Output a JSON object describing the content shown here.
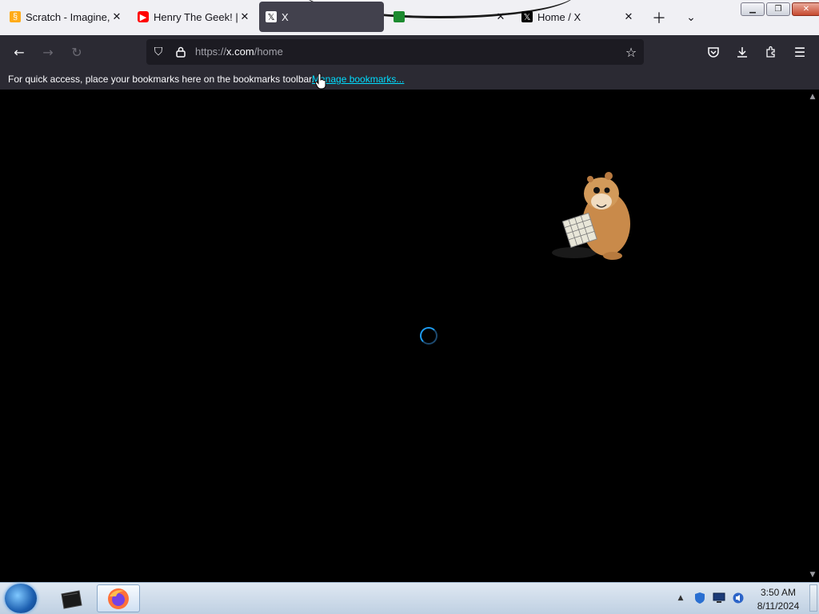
{
  "tabs": [
    {
      "title": "Scratch - Imagine, P",
      "favicon": "scratch-icon"
    },
    {
      "title": "Henry The Geek! | H",
      "favicon": "youtube-icon"
    },
    {
      "title": "X",
      "favicon": "x-icon",
      "active": true
    },
    {
      "title": "",
      "favicon": "green-site-icon"
    },
    {
      "title": "Home / X",
      "favicon": "x-icon"
    }
  ],
  "nav": {
    "url_prefix": "https://",
    "url_host": "x.com",
    "url_path": "/home"
  },
  "bookmarks_bar": {
    "message": "For quick access, place your bookmarks here on the bookmarks toolbar.",
    "link": "Manage bookmarks..."
  },
  "clock": {
    "time": "3:50 AM",
    "date": "8/11/2024"
  },
  "colors": {
    "accent_link": "#00ddff",
    "spinner": "#1d9bf0",
    "toolbar": "#2b2a33",
    "tabstrip": "#f0f0f4"
  }
}
